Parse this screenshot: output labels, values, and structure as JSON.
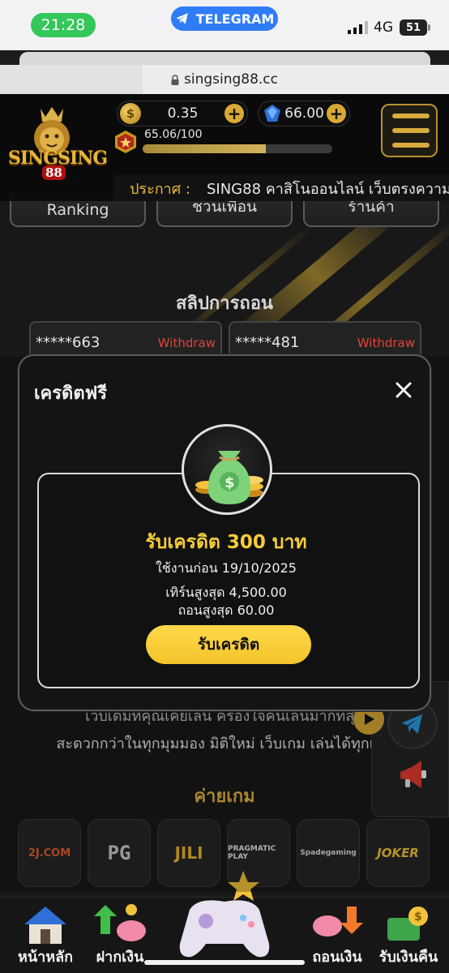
{
  "status_bar": {
    "time": "21:28",
    "telegram_label": "TELEGRAM",
    "network": "4G",
    "battery": "51"
  },
  "browser": {
    "url": "singsing88.cc"
  },
  "header": {
    "logo_text": "SINGSING",
    "logo_number": "88",
    "coin_balance": "0.35",
    "gem_balance": "66.00",
    "xp_label": "65.06/100",
    "xp_fraction": 0.6506,
    "announce_label": "ประกาศ :",
    "announce_text": "SING88 คาสิโนออนไลน์ เว็บตรงความ"
  },
  "nav_cards": {
    "ranking": "Ranking",
    "invite": "ชวนเพื่อน",
    "shop": "ร้านค้า"
  },
  "withdraw_section": {
    "title": "สลิปการถอน",
    "slips": [
      {
        "user": "*****663",
        "tag": "Withdraw"
      },
      {
        "user": "*****481",
        "tag": "Withdraw"
      }
    ]
  },
  "behind_text": {
    "line1": "เว็บเดิมที่คุณเคยเล่น ครองใจคนเล่นมากที่สุด",
    "line2": "สะดวกกว่าในทุกมุมมอง มิติใหม่ เว็บเกม เล่นได้ทุกเกม"
  },
  "providers_section": {
    "title": "ค่ายเกม",
    "providers": [
      "2J.COM",
      "PG",
      "JILI",
      "PRAGMATIC PLAY",
      "Spadegaming",
      "JOKER"
    ]
  },
  "bottom_nav": {
    "home": "หน้าหลัก",
    "deposit": "ฝากเงิน",
    "withdraw": "ถอนเงิน",
    "cashback": "รับเงินคืน"
  },
  "modal": {
    "title": "เครดิตฟรี",
    "credit_title": "รับเครดิต 300 บาท",
    "use_before": "ใช้งานก่อน 19/10/2025",
    "max_turnover": "เทิร์นสูงสุด 4,500.00",
    "max_withdraw": "ถอนสูงสุด 60.00",
    "claim_label": "รับเครดิต"
  },
  "colors": {
    "accent_gold": "#d8a935",
    "credit_yellow": "#f6cd3a",
    "withdraw_red": "#e0443a",
    "telegram_blue": "#2f7cf6"
  }
}
